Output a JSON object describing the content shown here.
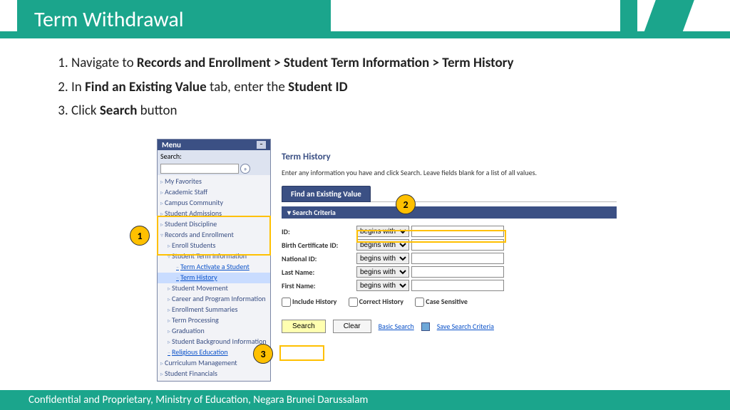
{
  "title": "Term Withdrawal",
  "instructions": {
    "i1_pre": "Navigate to ",
    "i1_bold": "Records and Enrollment > Student Term Information > Term History",
    "i2_pre": "In ",
    "i2_b1": "Find an Existing Value",
    "i2_mid": " tab, enter the ",
    "i2_b2": "Student ID",
    "i3_pre": "Click ",
    "i3_b1": "Search",
    "i3_post": " button"
  },
  "callouts": {
    "c1": "1",
    "c2": "2",
    "c3": "3"
  },
  "menu": {
    "header": "Menu",
    "search_label": "Search:",
    "items": {
      "fav": "My Favorites",
      "staff": "Academic Staff",
      "campus": "Campus Community",
      "admissions": "Student Admissions",
      "discipline": "Student Discipline",
      "records": "Records and Enrollment",
      "enroll": "Enroll Students",
      "termInfo": "Student Term Information",
      "activate": "Term Activate a Student",
      "termHistory": "Term History",
      "movement": "Student Movement",
      "career": "Career and Program Information",
      "summaries": "Enrollment Summaries",
      "termProc": "Term Processing",
      "grad": "Graduation",
      "background": "Student Background Information",
      "religious": "Religious Education",
      "curriculum": "Curriculum Management",
      "financials": "Student Financials"
    }
  },
  "form": {
    "heading": "Term History",
    "hint": "Enter any information you have and click Search. Leave fields blank for a list of all values.",
    "tab": "Find an Existing Value",
    "criteria": "Search Criteria",
    "fields": {
      "id": "ID:",
      "birth": "Birth Certificate ID:",
      "national": "National ID:",
      "last": "Last Name:",
      "first": "First Name:"
    },
    "op_default": "begins with",
    "checks": {
      "include": "Include History",
      "correct": "Correct History",
      "case": "Case Sensitive"
    },
    "buttons": {
      "search": "Search",
      "clear": "Clear",
      "basic": "Basic Search",
      "save": "Save Search Criteria"
    }
  },
  "footer": "Confidential and Proprietary, Ministry of Education, Negara Brunei Darussalam"
}
